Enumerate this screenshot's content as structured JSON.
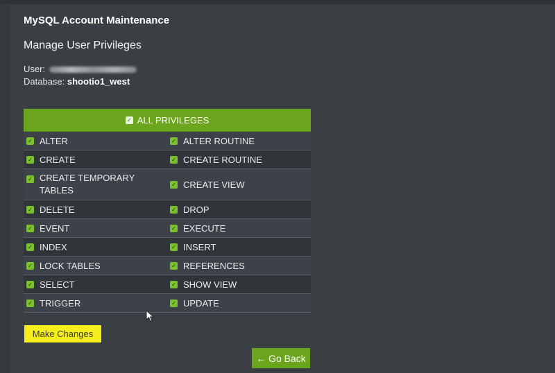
{
  "header": {
    "title": "MySQL Account Maintenance",
    "subtitle": "Manage User Privileges",
    "user_label": "User:",
    "database_label": "Database:",
    "database_value": "shootio1_west"
  },
  "privileges": {
    "all_label": "ALL PRIVILEGES",
    "all_checked": true,
    "rows": [
      [
        {
          "label": "ALTER",
          "checked": true
        },
        {
          "label": "ALTER ROUTINE",
          "checked": true
        }
      ],
      [
        {
          "label": "CREATE",
          "checked": true
        },
        {
          "label": "CREATE ROUTINE",
          "checked": true
        }
      ],
      [
        {
          "label": "CREATE TEMPORARY TABLES",
          "checked": true
        },
        {
          "label": "CREATE VIEW",
          "checked": true
        }
      ],
      [
        {
          "label": "DELETE",
          "checked": true
        },
        {
          "label": "DROP",
          "checked": true
        }
      ],
      [
        {
          "label": "EVENT",
          "checked": true
        },
        {
          "label": "EXECUTE",
          "checked": true
        }
      ],
      [
        {
          "label": "INDEX",
          "checked": true
        },
        {
          "label": "INSERT",
          "checked": true
        }
      ],
      [
        {
          "label": "LOCK TABLES",
          "checked": true
        },
        {
          "label": "REFERENCES",
          "checked": true
        }
      ],
      [
        {
          "label": "SELECT",
          "checked": true
        },
        {
          "label": "SHOW VIEW",
          "checked": true
        }
      ],
      [
        {
          "label": "TRIGGER",
          "checked": true
        },
        {
          "label": "UPDATE",
          "checked": true
        }
      ]
    ]
  },
  "buttons": {
    "make_changes": "Make Changes",
    "go_back": "← Go Back"
  },
  "colors": {
    "accent_green": "#6aa51d",
    "highlight_yellow": "#f5ee1c",
    "background": "#3a3f44"
  },
  "icons": {
    "checkbox": "check-icon",
    "cursor": "mouse-pointer-icon"
  }
}
